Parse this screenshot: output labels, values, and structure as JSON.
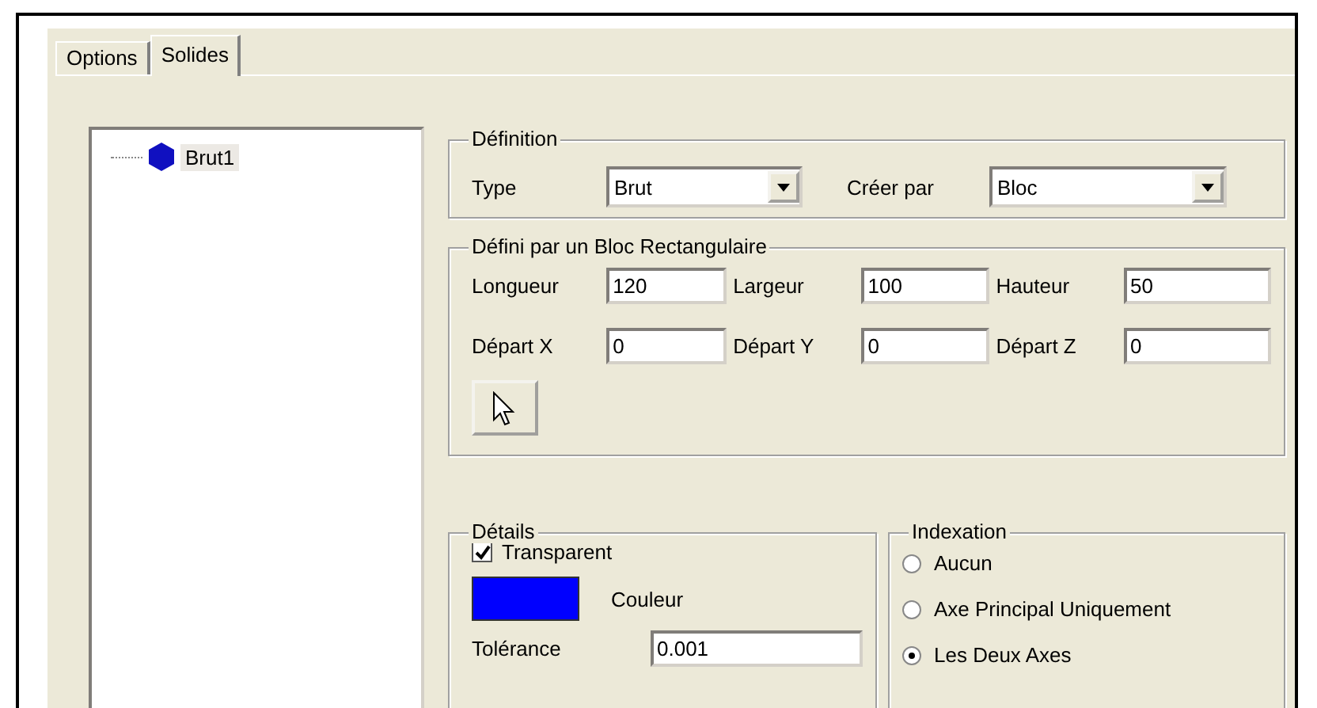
{
  "tabs": [
    {
      "label": "Options",
      "selected": false
    },
    {
      "label": "Solides",
      "selected": true
    }
  ],
  "tree": {
    "items": [
      {
        "label": "Brut1",
        "selected": true
      }
    ]
  },
  "definition": {
    "title": "Définition",
    "fields": [
      {
        "label": "Type",
        "value": "Brut"
      },
      {
        "label": "Créer par",
        "value": "Bloc"
      }
    ]
  },
  "block": {
    "title": "Défini par un Bloc Rectangulaire",
    "fields": [
      {
        "label": "Longueur",
        "value": "120"
      },
      {
        "label": "Largeur",
        "value": "100"
      },
      {
        "label": "Hauteur",
        "value": "50"
      },
      {
        "label": "Départ X",
        "value": "0"
      },
      {
        "label": "Départ Y",
        "value": "0"
      },
      {
        "label": "Départ Z",
        "value": "0"
      }
    ]
  },
  "details": {
    "title": "Détails",
    "transparent": {
      "label": "Transparent",
      "checked": true
    },
    "color": "#0000ff",
    "color_label": "Couleur",
    "tolerance": {
      "label": "Tolérance",
      "value": "0.001"
    }
  },
  "indexation": {
    "title": "Indexation",
    "options": [
      {
        "label": "Aucun",
        "selected": false
      },
      {
        "label": "Axe Principal Uniquement",
        "selected": false
      },
      {
        "label": "Les Deux Axes",
        "selected": true
      }
    ]
  }
}
